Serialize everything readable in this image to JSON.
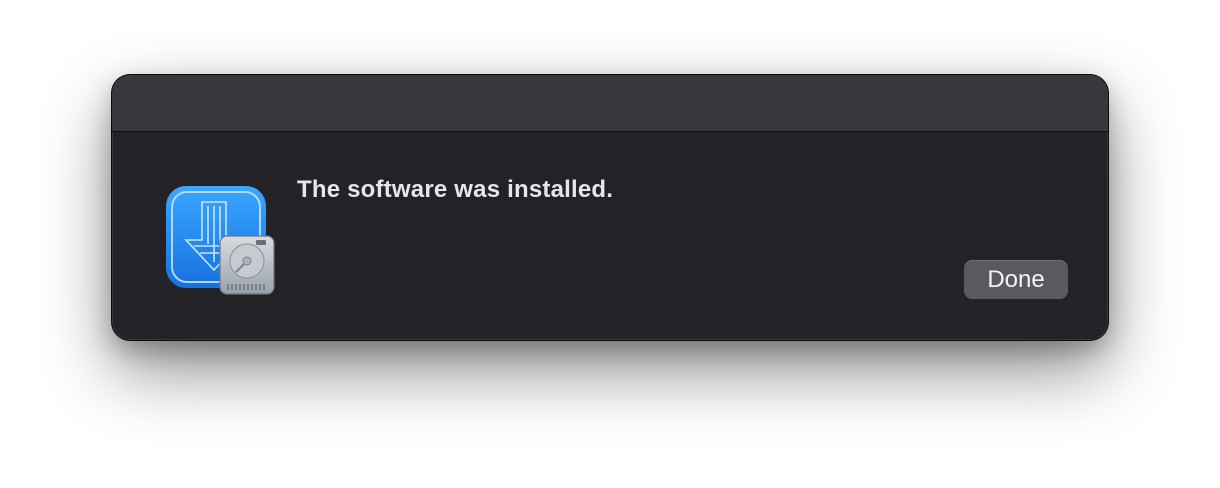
{
  "dialog": {
    "message": "The software was installed.",
    "done_label": "Done",
    "icon": "installer-icon"
  },
  "colors": {
    "window_background": "#232327",
    "titlebar_background": "#38373c",
    "message_text": "#e6e6e8",
    "button_background": "#5a595e",
    "icon_blue": "#1e88f0"
  }
}
